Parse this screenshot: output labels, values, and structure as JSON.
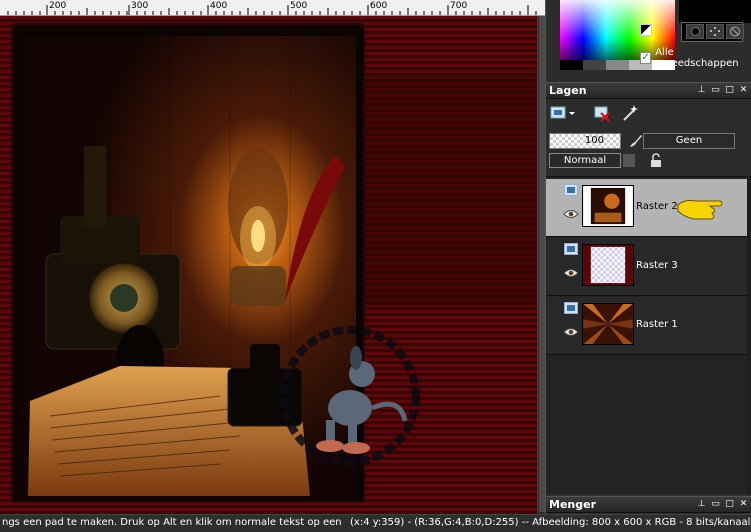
{
  "ruler": {
    "labels": [
      "200",
      "300",
      "400",
      "500",
      "600",
      "700"
    ]
  },
  "materials": {
    "all_tools_label": "Alle gereedschappen",
    "all_tools_checked": true
  },
  "layers_panel": {
    "title": "Lagen",
    "opacity": "100",
    "mask_label": "Geen",
    "blend_mode": "Normaal",
    "layers": [
      {
        "name": "Raster 2",
        "selected": true
      },
      {
        "name": "Raster 3",
        "selected": false
      },
      {
        "name": "Raster 1",
        "selected": false
      }
    ]
  },
  "mixer_panel": {
    "title": "Menger"
  },
  "statusbar": {
    "hint": "ngs een pad te maken. Druk op Alt en klik om normale tekst op een ve",
    "info": "(x:4 y:359) - (R:36,G:4,B:0,D:255) -- Afbeelding:  800 x 600 x RGB - 8 bits/kanaal"
  },
  "colors": {
    "canvas_frame": "#5a0909",
    "panel_bg": "#2c2c2c",
    "selected_layer": "#b3b3b3",
    "accent_hand": "#f5d400"
  }
}
